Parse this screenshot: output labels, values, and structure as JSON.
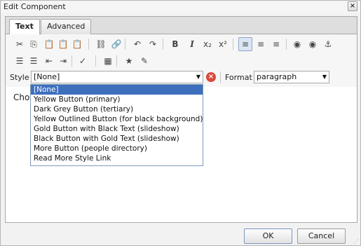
{
  "dialog": {
    "title": "Edit Component",
    "close_glyph": "×"
  },
  "tabs": [
    {
      "label": "Text",
      "active": true
    },
    {
      "label": "Advanced",
      "active": false
    }
  ],
  "toolbar": {
    "row1": [
      {
        "name": "cut-icon",
        "glyph": "✂"
      },
      {
        "name": "copy-icon",
        "glyph": "⎘"
      },
      {
        "name": "paste-icon",
        "glyph": "📋"
      },
      {
        "name": "paste-text-icon",
        "glyph": "📋"
      },
      {
        "name": "paste-word-icon",
        "glyph": "📋"
      },
      {
        "name": "unlink-icon",
        "glyph": "⛓"
      },
      {
        "name": "link-icon",
        "glyph": "🔗"
      },
      {
        "name": "undo-icon",
        "glyph": "↶"
      },
      {
        "name": "redo-icon",
        "glyph": "↷"
      },
      {
        "name": "bold-icon",
        "glyph": "B"
      },
      {
        "name": "italic-icon",
        "glyph": "I"
      },
      {
        "name": "subscript-icon",
        "glyph": "x₂"
      },
      {
        "name": "superscript-icon",
        "glyph": "x²"
      },
      {
        "name": "align-left-icon",
        "glyph": "≡",
        "pressed": true
      },
      {
        "name": "align-center-icon",
        "glyph": "≡"
      },
      {
        "name": "align-right-icon",
        "glyph": "≡"
      },
      {
        "name": "image-insert-icon",
        "glyph": "◉"
      },
      {
        "name": "image-remove-icon",
        "glyph": "◉"
      },
      {
        "name": "anchor-icon",
        "glyph": "⚓"
      }
    ],
    "row2": [
      {
        "name": "bulleted-list-icon",
        "glyph": "☰"
      },
      {
        "name": "numbered-list-icon",
        "glyph": "☰"
      },
      {
        "name": "outdent-icon",
        "glyph": "⇤"
      },
      {
        "name": "indent-icon",
        "glyph": "⇥"
      },
      {
        "name": "spellcheck-icon",
        "glyph": "✓"
      },
      {
        "name": "table-icon",
        "glyph": "▦"
      },
      {
        "name": "special-char-icon",
        "glyph": "★"
      },
      {
        "name": "source-edit-icon",
        "glyph": "✎"
      }
    ]
  },
  "style_row": {
    "style_label": "Style",
    "style_value": "[None]",
    "arrow_glyph": "▼",
    "clear_glyph": "×",
    "format_label": "Format",
    "format_value": "paragraph"
  },
  "editor": {
    "text_visible": "Choc"
  },
  "style_options": [
    {
      "label": "[None]",
      "selected": true
    },
    {
      "label": "Yellow Button (primary)"
    },
    {
      "label": "Dark Grey Button (tertiary)"
    },
    {
      "label": "Yellow Outlined Button (for black background)"
    },
    {
      "label": "Gold Button with Black Text (slideshow)"
    },
    {
      "label": "Black Button with Gold Text (slideshow)"
    },
    {
      "label": "More Button (people directory)"
    },
    {
      "label": "Read More Style Link"
    }
  ],
  "footer": {
    "ok_label": "OK",
    "cancel_label": "Cancel"
  }
}
